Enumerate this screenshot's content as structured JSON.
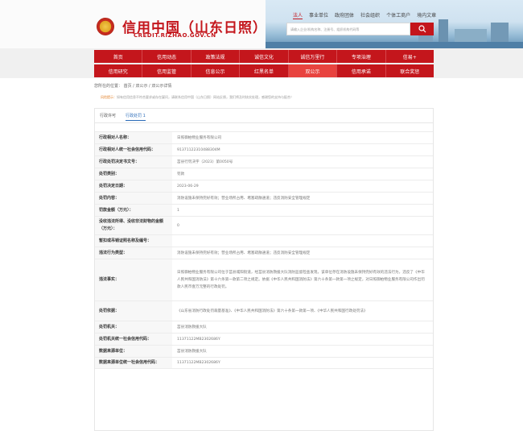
{
  "header": {
    "site_title": "信用中国（山东日照）",
    "site_url": "CREDIT.RIZHAO.GOV.CN",
    "top_links": [
      "法人",
      "事业单位",
      "政府团体",
      "社会组织",
      "个体工商户",
      "境内文章"
    ],
    "search_placeholder": "请输入企业/机构名称、注册号、组织机构代码等"
  },
  "nav": {
    "row1": [
      "首页",
      "信用动态",
      "政策法规",
      "诚信文化",
      "诚信万里行",
      "专项治理",
      "信易+"
    ],
    "row2": [
      "信用研究",
      "信用监管",
      "信息公示",
      "红黑名单",
      "双公示",
      "信用承诺",
      "联合奖惩"
    ],
    "active": "双公示"
  },
  "breadcrumb": "您所在的位置： 首页 / 双公示 / 双公示详情",
  "notice": {
    "label": "风险提示：",
    "text": "如有信用信息不符合要求或存在疑问，请联系信用中国（山东日照）网站反馈，我们将及时核实处理，感谢您的支持与配合！"
  },
  "tabs": [
    "行政许可",
    "行政处罚 1"
  ],
  "fields": [
    {
      "label": "行政相对人名称：",
      "value": "日照御柏物业服务有限公司"
    },
    {
      "label": "行政相对人统一社会信用代码：",
      "value": "91371122310488304M"
    },
    {
      "label": "行政处罚决定书文号：",
      "value": "莒县行罚决字（2023）第0050号"
    },
    {
      "label": "处罚类别：",
      "value": "罚款"
    },
    {
      "label": "处罚决定日期：",
      "value": "2023-06-29"
    },
    {
      "label": "处罚内容：",
      "value": "消防设施未保持完好有效；营业场所占用、堵塞疏散通道；违反消防安全管理规定"
    },
    {
      "label": "罚款金额（万元）：",
      "value": "1"
    },
    {
      "label": "没收违法所得、没收非法财物的金额（万元）：",
      "value": "0"
    },
    {
      "label": "暂扣或吊销证照名称及编号：",
      "value": ""
    },
    {
      "label": "违法行为类型：",
      "value": "消防设施未保持完好有效；营业场所占用、堵塞疏散通道；违反消防安全管理规定"
    },
    {
      "label": "违法事实：",
      "value": "日照御柏物业服务有限公司位于莒县城阳街道，经莒县消防救援大队消防监督检查发现，该单位存在消防设施未保持完好有效的违法行为，违反了《中华人民共和国消防法》第十六条第一款第二项之规定。依据《中华人民共和国消防法》第六十条第一款第一项之规定，对日照御柏物业服务有限公司作出罚款人民币壹万元整的行政处罚。"
    },
    {
      "label": "处罚依据：",
      "value": "《山东省消防行政处罚裁量基准》、《中华人民共和国消防法》第六十条第一款第一项、《中华人民共和国行政处罚法》"
    },
    {
      "label": "处罚机关：",
      "value": "莒县消防救援大队"
    },
    {
      "label": "处罚机关统一社会信用代码：",
      "value": "11371122MB2302686Y"
    },
    {
      "label": "数据来源单位：",
      "value": "莒县消防救援大队"
    },
    {
      "label": "数据来源单位统一社会信用代码：",
      "value": "11371122MB2302686Y"
    }
  ]
}
